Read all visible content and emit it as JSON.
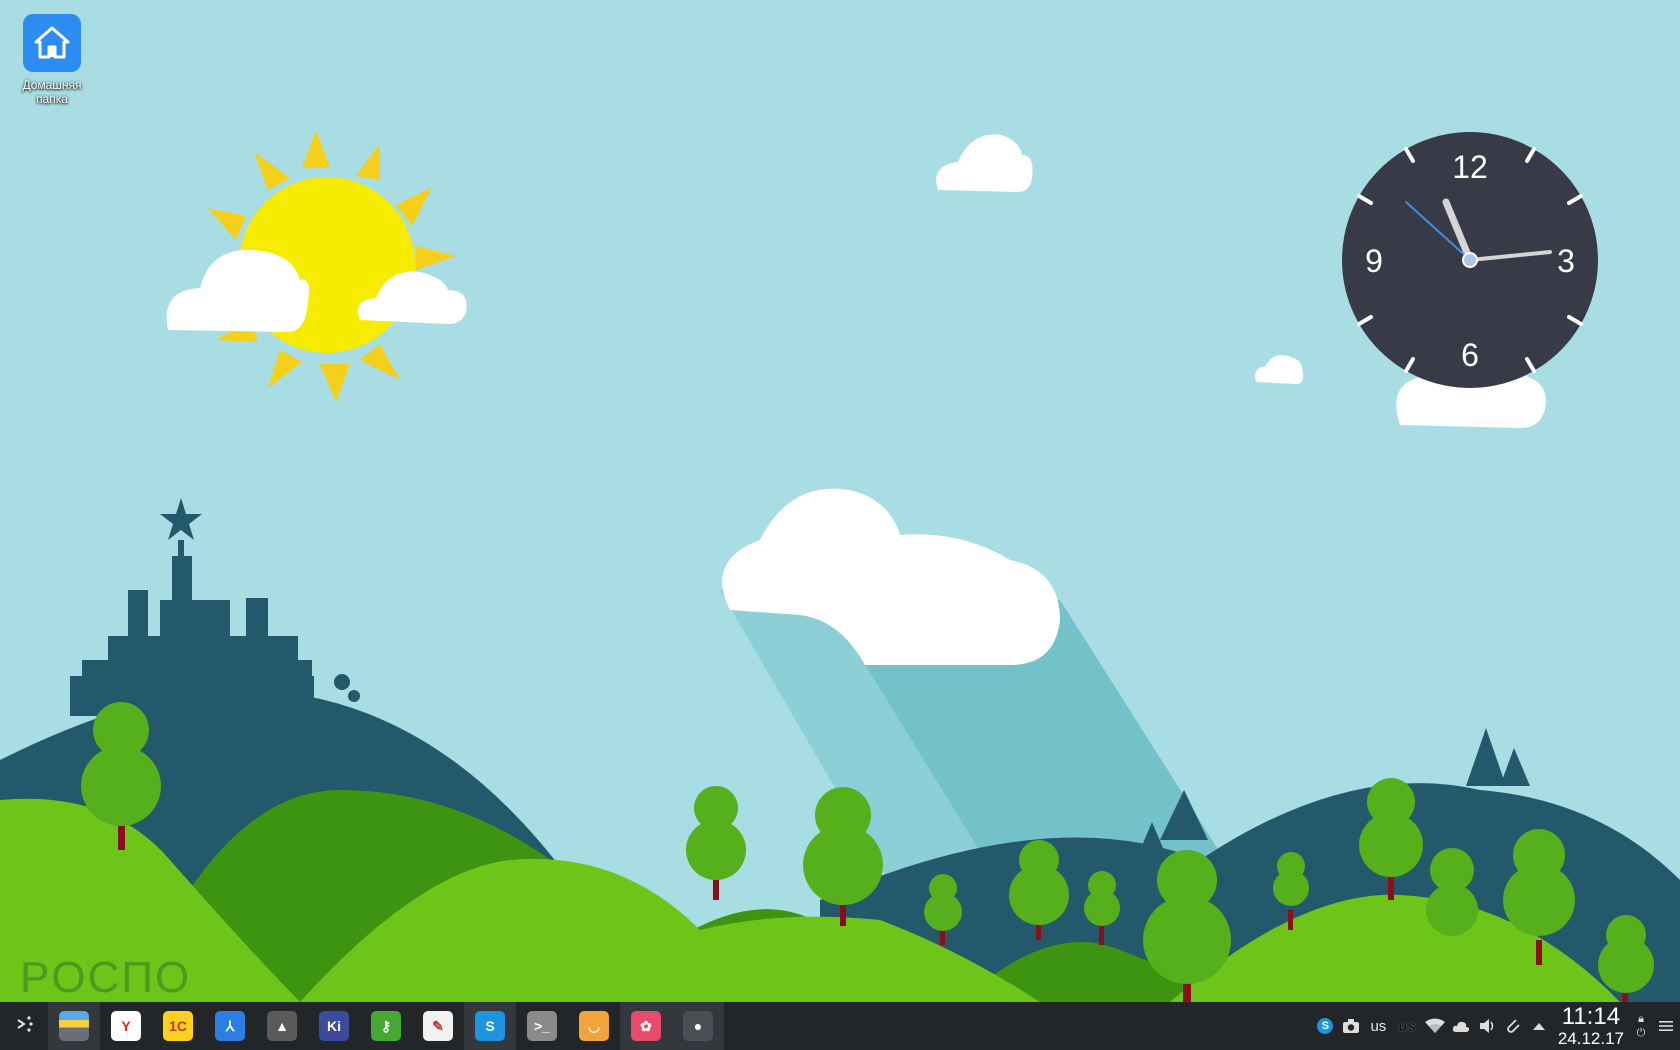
{
  "desktop": {
    "home_icon": {
      "label": "Домашняя папка",
      "icon": "house-icon",
      "color": "#2d8cf0"
    },
    "wallpaper_logo": "PОСПО"
  },
  "clock_widget": {
    "numerals": {
      "twelve": "12",
      "three": "3",
      "six": "6",
      "nine": "9"
    },
    "face_color": "#383a47",
    "time_shown": "11:14"
  },
  "taskbar": {
    "launcher_icon": "application-launcher-icon",
    "tasks": [
      {
        "name": "file-manager",
        "icon": "file-manager-icon",
        "glyph": "",
        "color": "#6a6f75",
        "active": true
      },
      {
        "name": "yandex-browser",
        "icon": "yandex-browser-icon",
        "glyph": "Y",
        "color": "#ffffff",
        "active": false
      },
      {
        "name": "1c-enterprise",
        "icon": "1c-icon",
        "glyph": "1С",
        "color": "#ffd01f",
        "active": false
      },
      {
        "name": "kdevelop",
        "icon": "kdevelop-icon",
        "glyph": "⅄",
        "color": "#2a7ee4",
        "active": false
      },
      {
        "name": "inkscape",
        "icon": "inkscape-icon",
        "glyph": "▲",
        "color": "#5a5a5a",
        "active": false
      },
      {
        "name": "kile",
        "icon": "kile-icon",
        "glyph": "Ki",
        "color": "#3c4a9c",
        "active": false
      },
      {
        "name": "keepassxc",
        "icon": "password-manager-icon",
        "glyph": "⚷",
        "color": "#44a832",
        "active": false
      },
      {
        "name": "notes",
        "icon": "notes-icon",
        "glyph": "✎",
        "color": "#f1f1f1",
        "active": false
      },
      {
        "name": "skype",
        "icon": "skype-icon",
        "glyph": "S",
        "color": "#1c94e0",
        "active": true
      },
      {
        "name": "terminal",
        "icon": "terminal-icon",
        "glyph": ">_",
        "color": "#8a8a8a",
        "active": false
      },
      {
        "name": "software-center",
        "icon": "software-center-icon",
        "glyph": "◡",
        "color": "#f2a33a",
        "active": false
      },
      {
        "name": "photo-editor",
        "icon": "photo-editor-icon",
        "glyph": "✿",
        "color": "#e84a6a",
        "active": true
      },
      {
        "name": "camera",
        "icon": "camera-app-icon",
        "glyph": "●",
        "color": "#4a4f55",
        "active": true
      }
    ],
    "tray": {
      "keyboard_layout": "us",
      "keyboard_layout_bold": "us",
      "time": "11:14",
      "date": "24.12.17"
    }
  }
}
